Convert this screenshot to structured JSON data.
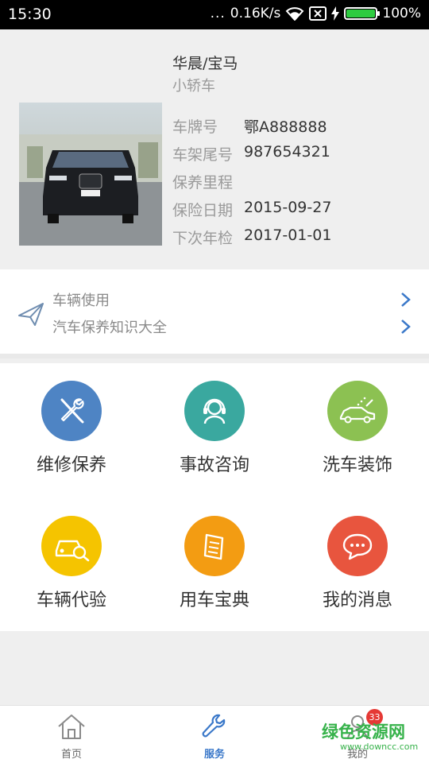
{
  "status_bar": {
    "time": "15:30",
    "dots": "...",
    "network_speed": "0.16K/s",
    "battery_percent": "100%",
    "battery_level": 1.0
  },
  "car": {
    "brand": "华晨/宝马",
    "type": "小轿车",
    "fields": [
      {
        "label": "车牌号",
        "value": "鄂A888888"
      },
      {
        "label": "车架尾号",
        "value": "987654321"
      },
      {
        "label": "保养里程",
        "value": ""
      },
      {
        "label": "保险日期",
        "value": "2015-09-27"
      },
      {
        "label": "下次年检",
        "value": "2017-01-01"
      }
    ]
  },
  "tips": {
    "items": [
      {
        "text": "车辆使用"
      },
      {
        "text": "汽车保养知识大全"
      }
    ]
  },
  "services": [
    {
      "label": "维修保养",
      "icon": "wrench-screwdriver-icon",
      "color": "#4e84c4"
    },
    {
      "label": "事故咨询",
      "icon": "headset-agent-icon",
      "color": "#3aa89f"
    },
    {
      "label": "洗车装饰",
      "icon": "car-wash-icon",
      "color": "#8cc152"
    },
    {
      "label": "车辆代验",
      "icon": "car-inspect-icon",
      "color": "#f5c400"
    },
    {
      "label": "用车宝典",
      "icon": "book-icon",
      "color": "#f39c12"
    },
    {
      "label": "我的消息",
      "icon": "chat-bubble-icon",
      "color": "#e8553e"
    }
  ],
  "bottom_nav": {
    "items": [
      {
        "label": "首页",
        "icon": "home-icon"
      },
      {
        "label": "服务",
        "icon": "wrench-icon"
      },
      {
        "label": "我的",
        "icon": "person-icon"
      }
    ],
    "active": "服务",
    "badge_count": "33"
  },
  "watermark": {
    "text": "绿色资源网",
    "sub": "www.downcc.com"
  }
}
